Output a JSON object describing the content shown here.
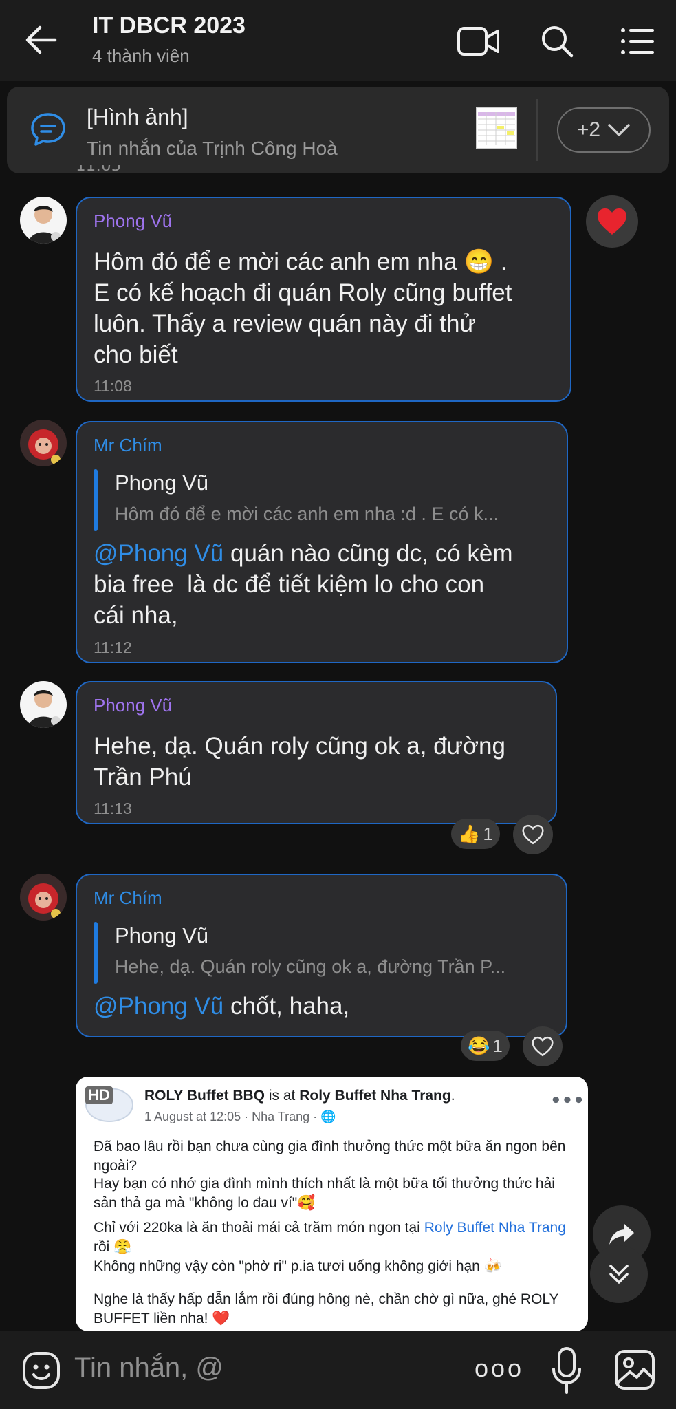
{
  "header": {
    "title": "IT DBCR 2023",
    "subtitle": "4 thành viên"
  },
  "pinned": {
    "title": "[Hình ảnh]",
    "subtitle": "Tin nhắn của Trịnh Công Hoà",
    "more": "+2"
  },
  "messages": [
    {
      "sender": "Phong Vũ",
      "lines": [
        "Hôm đó để e mời các anh em nha 😁 .",
        "E có kế hoạch đi quán Roly cũng buffet",
        "luôn. Thấy a review quán này đi thử",
        "cho biết"
      ],
      "time": "11:08",
      "reaction": "❤️"
    },
    {
      "sender": "Mr Chím",
      "quote_name": "Phong Vũ",
      "quote_text": "Hôm đó để e mời các anh em nha :d . E có k...",
      "mention": "@Phong Vũ",
      "line1_rest": " quán nào cũng dc, có kèm",
      "line2": "bia free  là dc để tiết kiệm lo cho con",
      "line3": "cái nha,",
      "time": "11:12"
    },
    {
      "sender": "Phong Vũ",
      "lines": [
        "Hehe, dạ. Quán roly cũng ok a, đường",
        "Trần Phú"
      ],
      "time": "11:13",
      "reaction_emoji": "👍",
      "reaction_count": "1"
    },
    {
      "sender": "Mr Chím",
      "quote_name": "Phong Vũ",
      "quote_text": "Hehe, dạ. Quán roly cũng ok a, đường Trần P...",
      "mention": "@Phong Vũ",
      "rest": " chốt, haha,",
      "reaction_emoji": "😂",
      "reaction_count": "1"
    }
  ],
  "post": {
    "hd_badge": "HD",
    "page": "ROLY Buffet BBQ",
    "is_at": " is at ",
    "place": "Roly Buffet Nha Trang",
    "period": ".",
    "meta": "1 August at 12:05 · Nha Trang · 🌐",
    "p1": "Đã bao lâu rồi bạn chưa cùng gia đình thưởng thức một bữa ăn ngon bên ngoài?",
    "p2": "Hay bạn có nhớ gia đình mình thích nhất là một bữa tối thưởng thức hải sản thả ga mà \"không lo đau ví\"🥰",
    "p3_a": "Chỉ với 220ka là ăn thoải mái cả trăm món ngon tại ",
    "p3_link": "Roly Buffet Nha Trang",
    "p3_b": " rồi 😤",
    "p4": "Không những vậy còn \"phờ ri\" p.ia tươi uống không giới hạn 🍻",
    "p5": "Nghe là thấy hấp dẫn lắm rồi đúng hông nè, chần chờ gì nữa, ghé ROLY BUFFET liền nha! ❤️"
  },
  "composer": {
    "placeholder": "Tin nhắn, @",
    "more": "ooo"
  },
  "colors": {
    "accent_blue": "#2f8de6",
    "sender_purple": "#9f74ef",
    "bubble_border": "#1f67c4",
    "bubble_bg": "#2b2b2d",
    "heart_red": "#e8242e"
  }
}
